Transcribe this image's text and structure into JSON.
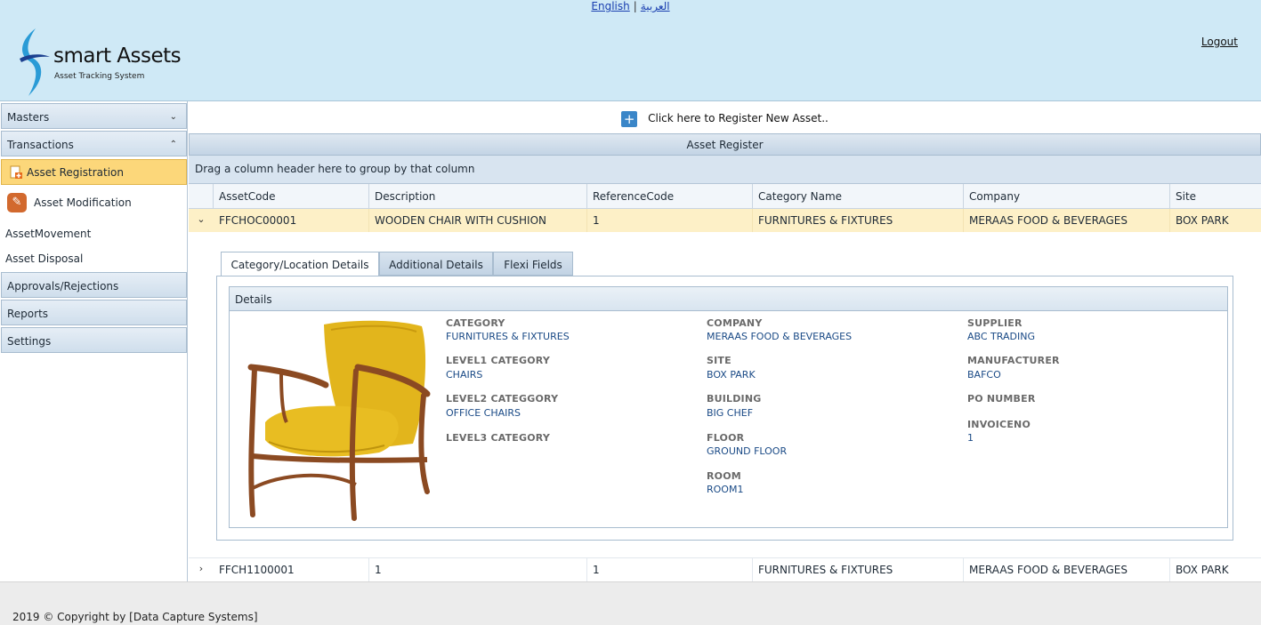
{
  "header": {
    "lang_english": "English",
    "lang_arabic": "العربية",
    "lang_separator": "|",
    "app_name": "smart Assets",
    "app_tagline": "Asset Tracking System",
    "logout": "Logout",
    "brand_color": "#cfe9f6"
  },
  "sidebar": {
    "masters": "Masters",
    "transactions": "Transactions",
    "asset_registration": "Asset Registration",
    "asset_modification": "Asset Modification",
    "asset_movement": "AssetMovement",
    "asset_disposal": "Asset Disposal",
    "approvals": "Approvals/Rejections",
    "reports": "Reports",
    "settings": "Settings"
  },
  "main": {
    "register_link": "Click here to Register New Asset..",
    "grid_title": "Asset Register",
    "group_hint": "Drag a column header here to group by that column",
    "columns": [
      "AssetCode",
      "Description",
      "ReferenceCode",
      "Category Name",
      "Company",
      "Site"
    ],
    "rows": [
      {
        "code": "FFCHOC00001",
        "description": "WOODEN CHAIR WITH CUSHION",
        "reference": "1",
        "category": "FURNITURES & FIXTURES",
        "company": "MERAAS FOOD & BEVERAGES",
        "site": "BOX PARK"
      },
      {
        "code": "FFCH1100001",
        "description": "1",
        "reference": "1",
        "category": "FURNITURES & FIXTURES",
        "company": "MERAAS FOOD & BEVERAGES",
        "site": "BOX PARK"
      }
    ]
  },
  "detail": {
    "tabs": [
      "Category/Location Details",
      "Additional Details",
      "Flexi Fields"
    ],
    "section_title": "Details",
    "category_label": "CATEGORY",
    "category_value": "FURNITURES & FIXTURES",
    "level1_label": "LEVEL1 CATEGORY",
    "level1_value": "CHAIRS",
    "level2_label": "LEVEL2 CATEGGORY",
    "level2_value": "OFFICE CHAIRS",
    "level3_label": "LEVEL3 CATEGORY",
    "company_label": "COMPANY",
    "company_value": "MERAAS FOOD & BEVERAGES",
    "site_label": "SITE",
    "site_value": "BOX PARK",
    "building_label": "BUILDING",
    "building_value": "BIG CHEF",
    "floor_label": "FLOOR",
    "floor_value": "GROUND FLOOR",
    "room_label": "ROOM",
    "room_value": "ROOM1",
    "supplier_label": "SUPPLIER",
    "supplier_value": "ABC TRADING",
    "manufacturer_label": "MANUFACTURER",
    "manufacturer_value": "BAFCO",
    "po_label": "PO NUMBER",
    "invoice_label": "INVOICENO",
    "invoice_value": "1"
  },
  "footer": {
    "copyright": "2019 © Copyright by [Data Capture Systems]"
  }
}
